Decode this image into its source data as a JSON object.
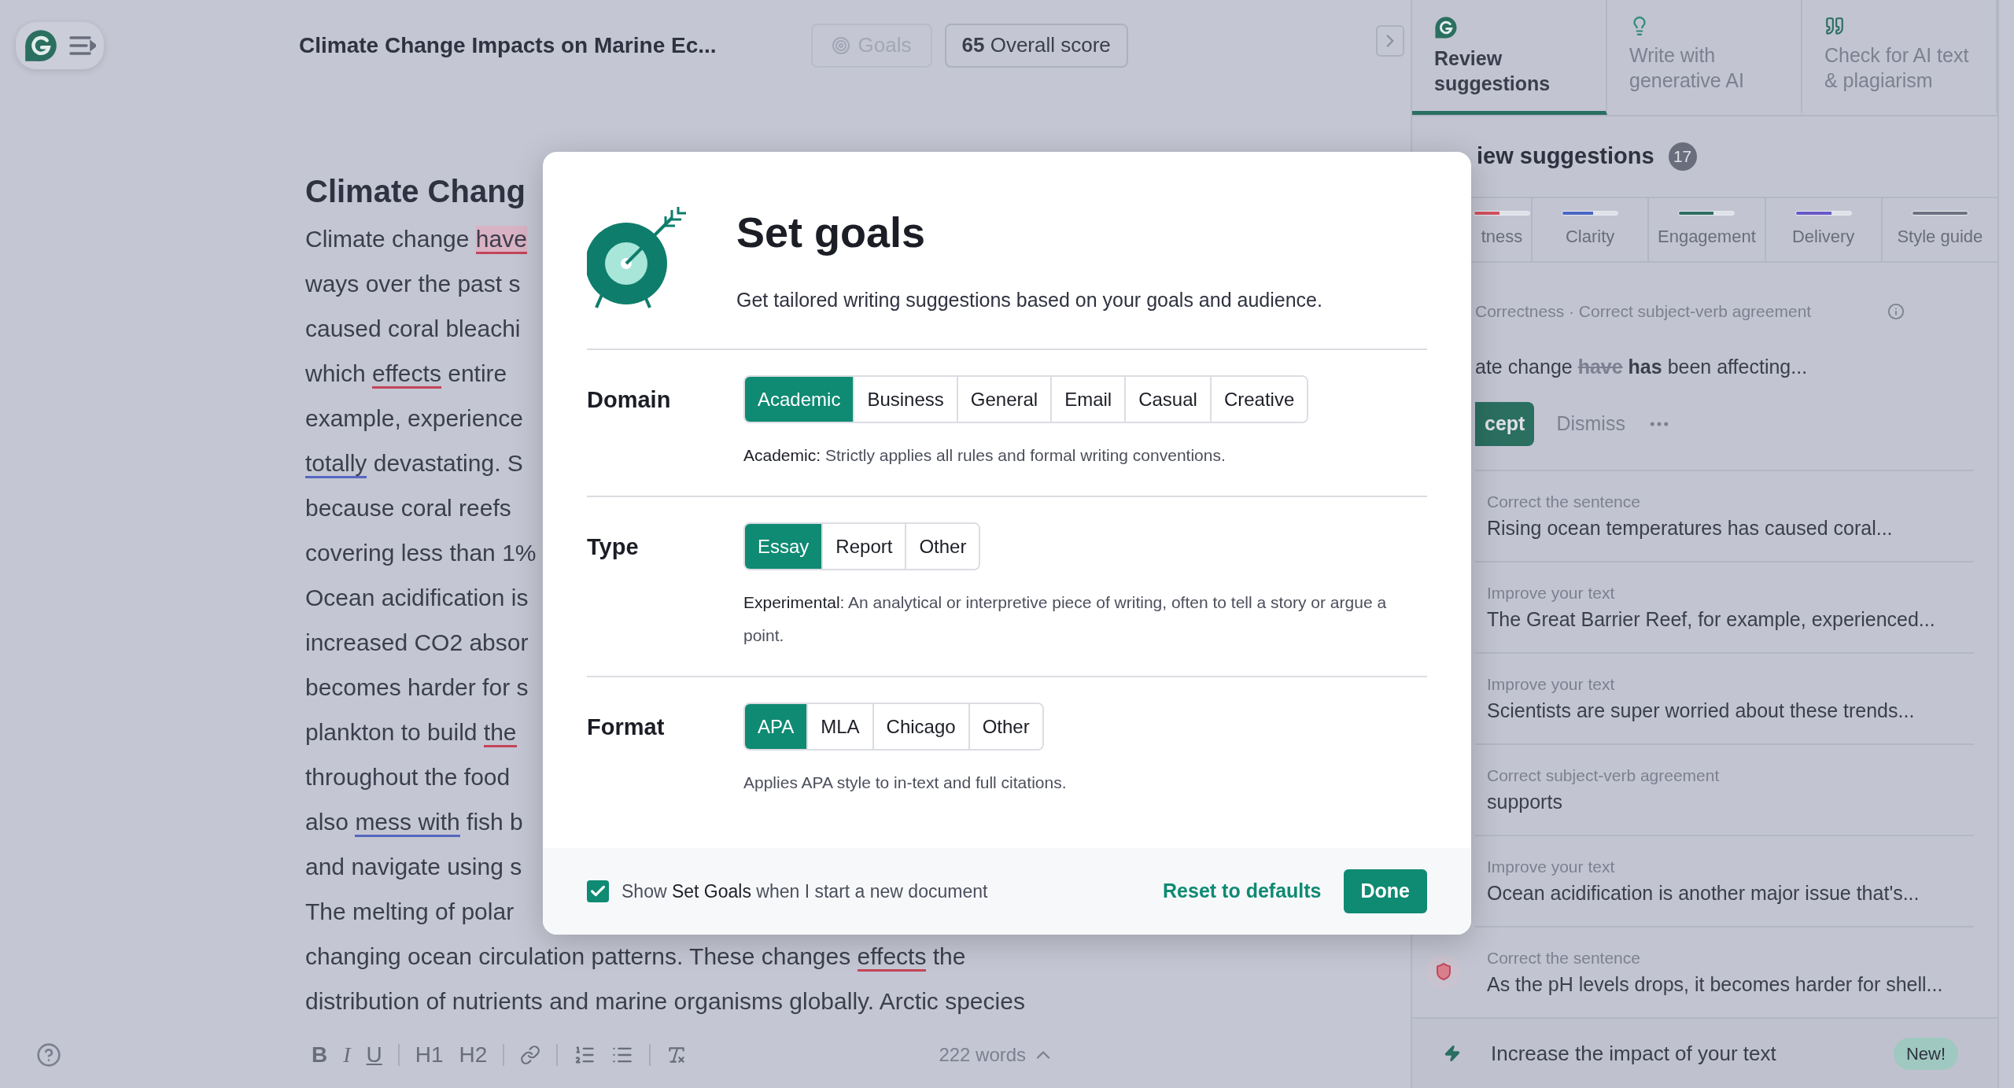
{
  "app_bar": {
    "document_title": "Climate Change Impacts on Marine Ec...",
    "goals_button": {
      "label": "Goals",
      "disabled": true
    },
    "score": {
      "value": "65",
      "label": "Overall score"
    }
  },
  "editor": {
    "heading": "Climate Chang",
    "lines": [
      {
        "segments": [
          {
            "text": "Climate change ",
            "kind": "plain"
          },
          {
            "text": "have",
            "kind": "error_highlight"
          }
        ]
      },
      {
        "segments": [
          {
            "text": "ways over the past s",
            "kind": "plain"
          }
        ]
      },
      {
        "segments": [
          {
            "text": "caused coral bleachi",
            "kind": "plain"
          }
        ]
      },
      {
        "segments": [
          {
            "text": "which ",
            "kind": "plain"
          },
          {
            "text": "effects",
            "kind": "error"
          },
          {
            "text": " entire",
            "kind": "plain"
          }
        ]
      },
      {
        "segments": [
          {
            "text": "example, experience",
            "kind": "plain"
          }
        ]
      },
      {
        "segments": [
          {
            "text": "totally",
            "kind": "clarity"
          },
          {
            "text": " devastating. S",
            "kind": "plain"
          }
        ]
      },
      {
        "segments": [
          {
            "text": "because coral reefs",
            "kind": "plain"
          }
        ]
      },
      {
        "segments": [
          {
            "text": "covering less than 1%",
            "kind": "plain"
          }
        ]
      },
      {
        "segments": [
          {
            "text": "Ocean acidification is",
            "kind": "plain"
          }
        ]
      },
      {
        "segments": [
          {
            "text": "increased CO2 absor",
            "kind": "plain"
          }
        ]
      },
      {
        "segments": [
          {
            "text": "becomes harder for s",
            "kind": "plain"
          }
        ]
      },
      {
        "segments": [
          {
            "text": "plankton to build ",
            "kind": "plain"
          },
          {
            "text": "the",
            "kind": "error"
          }
        ]
      },
      {
        "segments": [
          {
            "text": "throughout the food",
            "kind": "plain"
          }
        ]
      },
      {
        "segments": [
          {
            "text": "also ",
            "kind": "plain"
          },
          {
            "text": "mess with",
            "kind": "clarity"
          },
          {
            "text": " fish b",
            "kind": "plain"
          }
        ]
      },
      {
        "segments": [
          {
            "text": "and navigate using s",
            "kind": "plain"
          }
        ]
      },
      {
        "segments": [
          {
            "text": "The melting of polar",
            "kind": "plain"
          }
        ]
      },
      {
        "segments": [
          {
            "text": "changing ocean circulation patterns. These changes ",
            "kind": "plain"
          },
          {
            "text": "effects",
            "kind": "error"
          },
          {
            "text": " the",
            "kind": "plain"
          }
        ]
      },
      {
        "segments": [
          {
            "text": "distribution of nutrients and marine organisms globally. Arctic species",
            "kind": "plain"
          }
        ]
      }
    ]
  },
  "toolbar": {
    "items": [
      {
        "kind": "bold",
        "label": "B"
      },
      {
        "kind": "italic",
        "label": "I"
      },
      {
        "kind": "underline",
        "label": "U"
      },
      {
        "kind": "divider"
      },
      {
        "kind": "heading",
        "label": "H1"
      },
      {
        "kind": "heading",
        "label": "H2"
      },
      {
        "kind": "divider"
      },
      {
        "kind": "link"
      },
      {
        "kind": "divider"
      },
      {
        "kind": "ordered_list"
      },
      {
        "kind": "bullet_list"
      },
      {
        "kind": "divider"
      },
      {
        "kind": "clear_format"
      }
    ],
    "word_count": "222 words"
  },
  "sidebar": {
    "tabs": [
      {
        "label": "Review suggestions",
        "selected": true
      },
      {
        "label": "Write with generative AI",
        "selected": false
      },
      {
        "label": "Check for AI text & plagiarism",
        "selected": false
      }
    ],
    "heading": "iew suggestions",
    "count": "17",
    "categories": [
      {
        "label": "tness",
        "level": 0.45,
        "color": "#d2505e"
      },
      {
        "label": "Clarity",
        "level": 0.55,
        "color": "#4a67c4"
      },
      {
        "label": "Engagement",
        "level": 0.62,
        "color": "#2f6f62"
      },
      {
        "label": "Delivery",
        "level": 0.65,
        "color": "#6a58c8"
      },
      {
        "label": "Style guide",
        "level": 1,
        "color": "#6e7180"
      }
    ],
    "active_card": {
      "meta": "Correctness · Correct subject-verb agreement",
      "sentence": [
        {
          "text": "ate change ",
          "kind": "plain"
        },
        {
          "text": "have",
          "kind": "deleted"
        },
        {
          "text": " has",
          "kind": "inserted"
        },
        {
          "text": " been affecting...",
          "kind": "plain"
        }
      ],
      "accept": "cept",
      "dismiss": "Dismiss"
    },
    "suggestions": [
      {
        "title": "Correct the sentence",
        "text": "Rising ocean temperatures has caused coral...",
        "kind": "plain"
      },
      {
        "title": "Improve your text",
        "text": "The Great Barrier Reef, for example, experienced...",
        "kind": "plain"
      },
      {
        "title": "Improve your text",
        "text": "Scientists are super worried about these trends...",
        "kind": "plain"
      },
      {
        "title": "Correct subject-verb agreement",
        "text": "supports",
        "kind": "plain"
      },
      {
        "title": "Improve your text",
        "text": "Ocean acidification is another major issue that's...",
        "kind": "plain"
      },
      {
        "title": "Correct the sentence",
        "text": "As the pH levels drops, it becomes harder for shell...",
        "kind": "shield"
      }
    ],
    "promo": {
      "label": "Increase the impact of your text",
      "badge": "New!"
    }
  },
  "modal": {
    "title": "Set goals",
    "subtitle": "Get tailored writing suggestions based on your goals and audience.",
    "sections": [
      {
        "label": "Domain",
        "options": [
          {
            "label": "Academic",
            "selected": true
          },
          {
            "label": "Business",
            "selected": false
          },
          {
            "label": "General",
            "selected": false
          },
          {
            "label": "Email",
            "selected": false
          },
          {
            "label": "Casual",
            "selected": false
          },
          {
            "label": "Creative",
            "selected": false
          }
        ],
        "description": {
          "term": "Academic:",
          "text": " Strictly applies all rules and formal writing conventions."
        }
      },
      {
        "label": "Type",
        "options": [
          {
            "label": "Essay",
            "selected": true
          },
          {
            "label": "Report",
            "selected": false
          },
          {
            "label": "Other",
            "selected": false
          }
        ],
        "description": {
          "term": "Experimental",
          "text": ": An analytical or interpretive piece of writing, often to tell a story or argue a point."
        }
      },
      {
        "label": "Format",
        "options": [
          {
            "label": "APA",
            "selected": true
          },
          {
            "label": "MLA",
            "selected": false
          },
          {
            "label": "Chicago",
            "selected": false
          },
          {
            "label": "Other",
            "selected": false
          }
        ],
        "description": {
          "text": "Applies APA style to in-text and full citations."
        }
      }
    ],
    "footer": {
      "checkbox": {
        "checked": true,
        "label": "Show **Set Goals** when I start a new document"
      },
      "reset": "Reset to defaults",
      "done": "Done"
    }
  }
}
